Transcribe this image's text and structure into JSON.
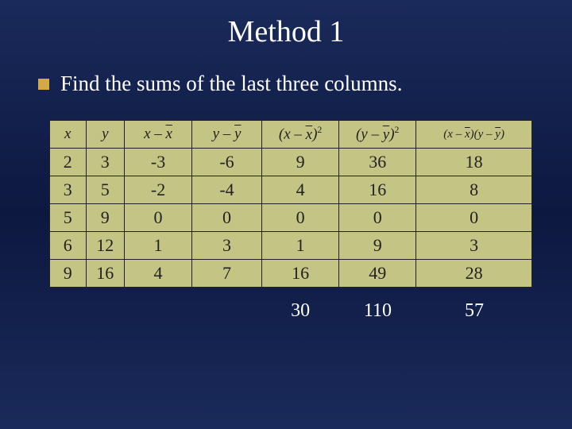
{
  "title": "Method 1",
  "bullet_text": "Find the sums of the last three columns.",
  "headers": {
    "h0": "x",
    "h1": "y",
    "h2_pre": "x – ",
    "h2_bar": "x",
    "h3_pre": "y – ",
    "h3_bar": "y",
    "h4_pre": "(x – ",
    "h4_bar": "x",
    "h4_post": ")",
    "h4_sup": "2",
    "h5_pre": "(y – ",
    "h5_bar": "y",
    "h5_post": ")",
    "h5_sup": "2",
    "h6_a_pre": "(x – ",
    "h6_a_bar": "x",
    "h6_a_post": ")",
    "h6_b_pre": "(y – ",
    "h6_b_bar": "y",
    "h6_b_post": ")"
  },
  "rows": [
    {
      "c0": "2",
      "c1": "3",
      "c2": "-3",
      "c3": "-6",
      "c4": "9",
      "c5": "36",
      "c6": "18"
    },
    {
      "c0": "3",
      "c1": "5",
      "c2": "-2",
      "c3": "-4",
      "c4": "4",
      "c5": "16",
      "c6": "8"
    },
    {
      "c0": "5",
      "c1": "9",
      "c2": "0",
      "c3": "0",
      "c4": "0",
      "c5": "0",
      "c6": "0"
    },
    {
      "c0": "6",
      "c1": "12",
      "c2": "1",
      "c3": "3",
      "c4": "1",
      "c5": "9",
      "c6": "3"
    },
    {
      "c0": "9",
      "c1": "16",
      "c2": "4",
      "c3": "7",
      "c4": "16",
      "c5": "49",
      "c6": "28"
    }
  ],
  "sums": {
    "s4": "30",
    "s5": "110",
    "s6": "57"
  }
}
